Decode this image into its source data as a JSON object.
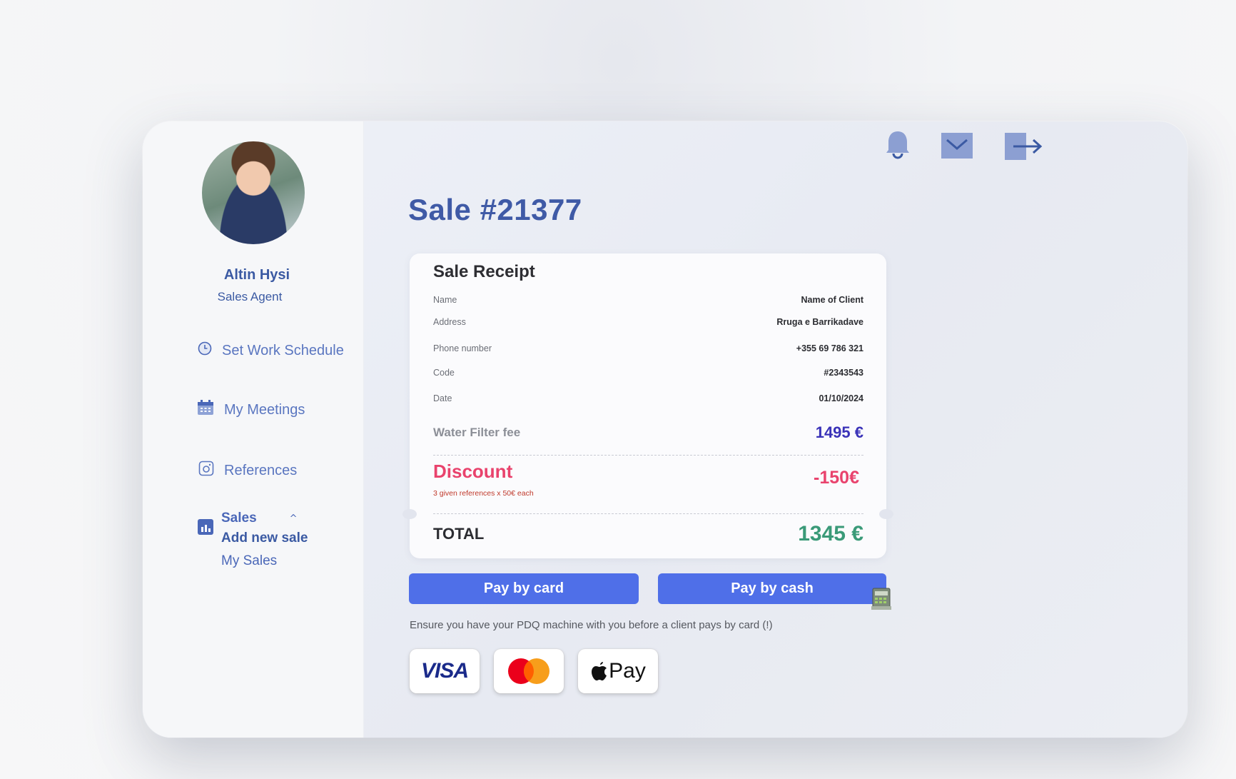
{
  "user": {
    "name": "Altin Hysi",
    "role": "Sales Agent"
  },
  "nav": {
    "schedule": "Set Work Schedule",
    "meetings": "My Meetings",
    "references": "References",
    "sales": "Sales",
    "add_new_sale": "Add new sale",
    "my_sales": "My Sales"
  },
  "header": {
    "icons": [
      "bell-icon",
      "mail-icon",
      "logout-icon"
    ]
  },
  "page": {
    "title": "Sale #21377"
  },
  "receipt": {
    "title": "Sale Receipt",
    "fields": [
      {
        "label": "Name",
        "value": "Name of Client"
      },
      {
        "label": "Address",
        "value": "Rruga e Barrikadave"
      },
      {
        "label": "Phone number",
        "value": "+355 69 786 321"
      },
      {
        "label": "Code",
        "value": "#2343543"
      },
      {
        "label": "Date",
        "value": "01/10/2024"
      }
    ],
    "fee_label": "Water Filter fee",
    "fee_value": "1495 €",
    "discount_label": "Discount",
    "discount_note": "3 given references x 50€ each",
    "discount_value": "-150€",
    "total_label": "TOTAL",
    "total_value": "1345 €"
  },
  "actions": {
    "card": "Pay by card",
    "cash": "Pay by cash"
  },
  "note": "Ensure you have your PDQ machine with you before a client pays by card (!)",
  "payment_logos": {
    "visa": "VISA",
    "mastercard": "mastercard-logo",
    "applepay": "Pay"
  },
  "colors": {
    "primary": "#4f6fe8",
    "title": "#3f5aa6",
    "discount": "#e9436d",
    "total": "#3a9a78",
    "fee": "#3a32b8"
  }
}
